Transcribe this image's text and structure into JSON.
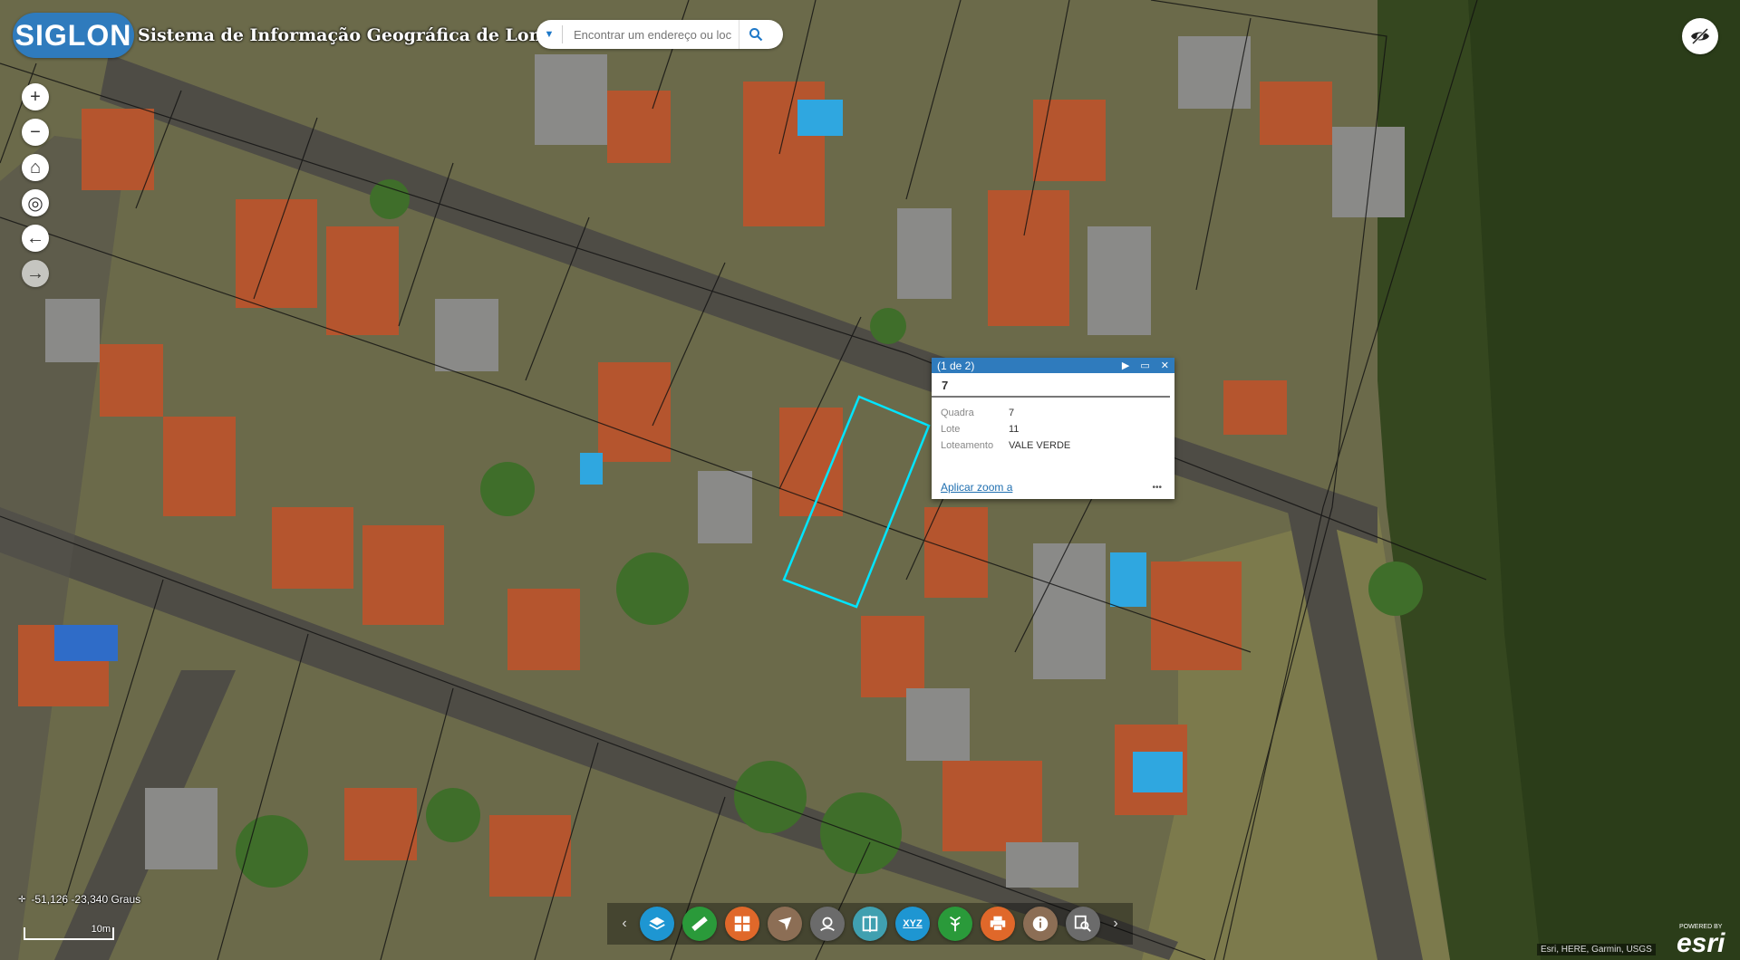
{
  "app": {
    "logo_text": "SIGLON",
    "title": "Sistema de Informação Geográfica de Londrina"
  },
  "search": {
    "placeholder": "Encontrar um endereço ou loc"
  },
  "map_tools": [
    {
      "name": "zoom-in-button",
      "glyph": "+"
    },
    {
      "name": "zoom-out-button",
      "glyph": "−"
    },
    {
      "name": "home-button",
      "glyph": "⌂"
    },
    {
      "name": "locate-button",
      "glyph": "◎"
    },
    {
      "name": "previous-extent-button",
      "glyph": "←"
    },
    {
      "name": "next-extent-button",
      "glyph": "→"
    }
  ],
  "popup": {
    "header": "(1 de 2)",
    "title": "7",
    "fields": [
      {
        "label": "Quadra",
        "value": "7"
      },
      {
        "label": "Lote",
        "value": "11"
      },
      {
        "label": "Loteamento",
        "value": "VALE VERDE"
      }
    ],
    "zoom_link": "Aplicar zoom a",
    "more": "•••"
  },
  "coordinates": "-51,126 -23,340 Graus",
  "scale_label": "10m",
  "toolbar": {
    "prev": "‹",
    "next": "›",
    "buttons": [
      {
        "name": "layers-button",
        "icon": "layers-icon",
        "color": "#1e96d2"
      },
      {
        "name": "measure-button",
        "icon": "ruler-icon",
        "color": "#2a9a3a"
      },
      {
        "name": "basemap-gallery-button",
        "icon": "grid-icon",
        "color": "#e0682a"
      },
      {
        "name": "draw-button",
        "icon": "pen-icon",
        "color": "#8c6e55"
      },
      {
        "name": "elevation-button",
        "icon": "terrain-icon",
        "color": "#6b6b6b"
      },
      {
        "name": "swipe-button",
        "icon": "swipe-icon",
        "color": "#40a0b0"
      },
      {
        "name": "xyz-button",
        "icon": "xyz-icon",
        "label": "XYZ",
        "color": "#1e96d2"
      },
      {
        "name": "share-button",
        "icon": "share-icon",
        "color": "#2a9a3a"
      },
      {
        "name": "print-button",
        "icon": "print-icon",
        "color": "#e0682a"
      },
      {
        "name": "about-button",
        "icon": "info-icon",
        "color": "#8c6e55"
      },
      {
        "name": "query-button",
        "icon": "query-icon",
        "color": "#6b6b6b"
      }
    ]
  },
  "attribution": "Esri, HERE, Garmin, USGS",
  "esri": {
    "powered": "POWERED BY",
    "brand": "esri"
  },
  "colors": {
    "brand_blue": "#2f7bbd",
    "highlight": "#00e5ff"
  }
}
